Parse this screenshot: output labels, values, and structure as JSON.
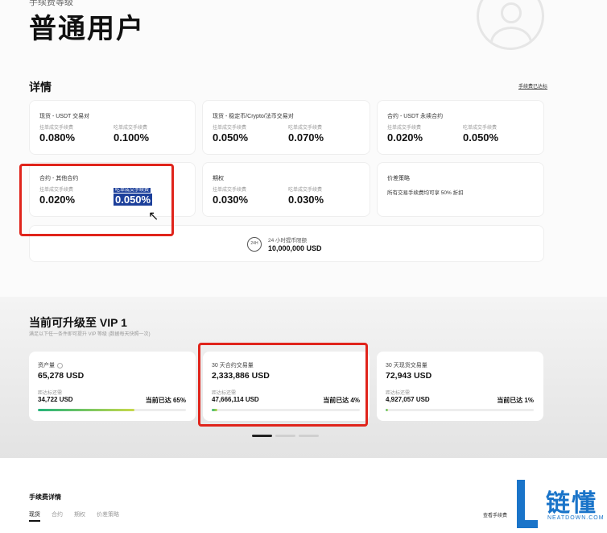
{
  "header": {
    "kicker": "手续费等级",
    "title": "普通用户"
  },
  "details": {
    "title": "详情",
    "link": "手续费已达标",
    "cards": [
      {
        "title": "现货 - USDT 交易对",
        "maker_label": "挂单成交手续费",
        "maker_value": "0.080%",
        "taker_label": "吃单成交手续费",
        "taker_value": "0.100%"
      },
      {
        "title": "现货 - 稳定币/Crypto/法币交易对",
        "maker_label": "挂单成交手续费",
        "maker_value": "0.050%",
        "taker_label": "吃单成交手续费",
        "taker_value": "0.070%"
      },
      {
        "title": "合约 - USDT 永续合约",
        "maker_label": "挂单成交手续费",
        "maker_value": "0.020%",
        "taker_label": "吃单成交手续费",
        "taker_value": "0.050%"
      },
      {
        "title": "合约 - 其他合约",
        "maker_label": "挂单成交手续费",
        "maker_value": "0.020%",
        "taker_label": "吃单成交手续费",
        "taker_value": "0.050%"
      },
      {
        "title": "期权",
        "maker_label": "挂单成交手续费",
        "maker_value": "0.030%",
        "taker_label": "吃单成交手续费",
        "taker_value": "0.030%"
      }
    ],
    "price_card": {
      "title": "价差策略",
      "desc": "所有交易手续费均可享 50% 折扣"
    },
    "withdraw_limit": {
      "icon_label": "24H",
      "label": "24 小时提币限额",
      "value": "10,000,000 USD"
    }
  },
  "vip": {
    "title": "当前可升级至 VIP 1",
    "subtitle": "满足以下任一条件即可提升 VIP 等级 (数据每天快照一次)",
    "cards": [
      {
        "title": "资产量",
        "value": "65,278 USD",
        "target_label": "距达标还需",
        "target_value": "34,722 USD",
        "pct_text": "当前已达 65%",
        "progress": 0.65
      },
      {
        "title": "30 天合约交易量",
        "value": "2,333,886 USD",
        "target_label": "距达标还需",
        "target_value": "47,666,114 USD",
        "pct_text": "当前已达 4%",
        "progress": 0.04
      },
      {
        "title": "30 天现货交易量",
        "value": "72,943 USD",
        "target_label": "距达标还需",
        "target_value": "4,927,057 USD",
        "pct_text": "当前已达 1%",
        "progress": 0.01
      }
    ]
  },
  "fees": {
    "title": "手续费详情",
    "tabs": [
      "现货",
      "合约",
      "期权",
      "价差策略"
    ],
    "right_link": "查看手续费"
  },
  "watermark": {
    "text": "链懂",
    "sub": "NEATDOWN.COM"
  },
  "colors": {
    "highlight_box": "#e0241b",
    "selection": "#1c3f9a",
    "progress_start": "#23b27a",
    "progress_end": "#c8d94a",
    "watermark": "#1a74c9"
  }
}
